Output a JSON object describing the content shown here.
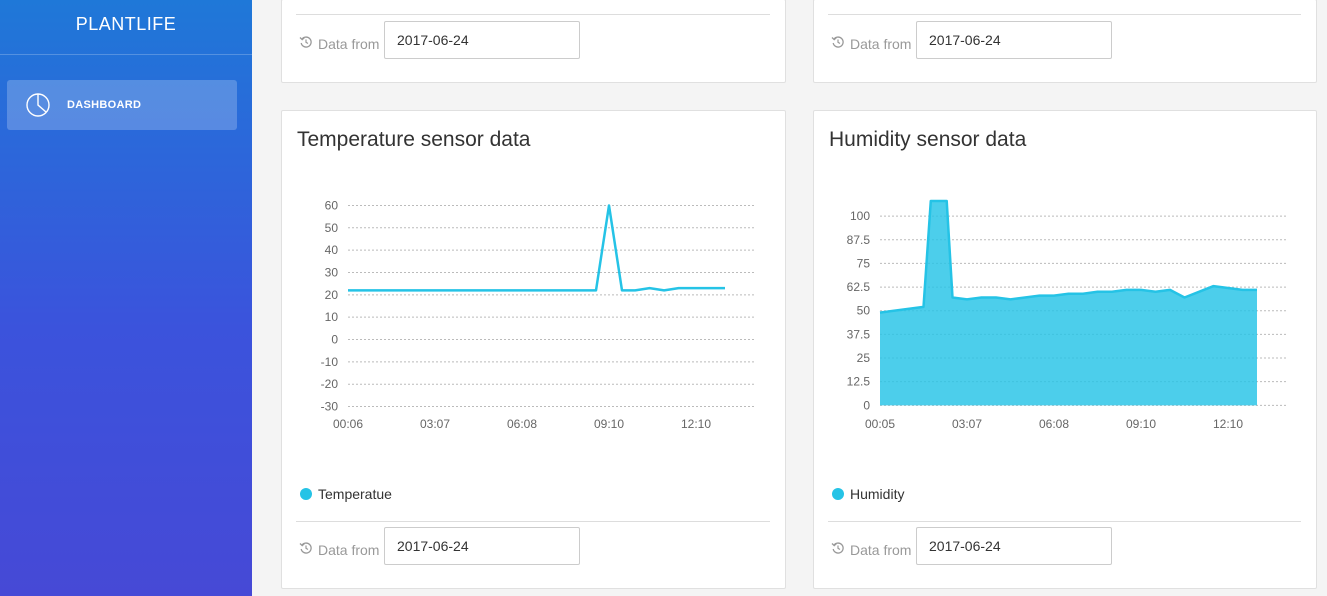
{
  "app": {
    "title": "PLANTLIFE"
  },
  "sidebar": {
    "items": [
      {
        "label": "DASHBOARD",
        "icon": "pie-chart-icon"
      }
    ]
  },
  "colors": {
    "accent": "#25c3e6",
    "sidebar_top": "#1f78d8",
    "sidebar_bottom": "#4649d6"
  },
  "top_cards": [
    {
      "footer": {
        "label": "Data from",
        "date": "2017-06-24",
        "icon": "history-icon"
      }
    },
    {
      "footer": {
        "label": "Data from",
        "date": "2017-06-24",
        "icon": "history-icon"
      }
    }
  ],
  "cards": [
    {
      "title": "Temperature sensor data",
      "legend": "Temperatue",
      "footer": {
        "label": "Data from",
        "date": "2017-06-24",
        "icon": "history-icon"
      }
    },
    {
      "title": "Humidity sensor data",
      "legend": "Humidity",
      "footer": {
        "label": "Data from",
        "date": "2017-06-24",
        "icon": "history-icon"
      }
    }
  ],
  "chart_data": [
    {
      "type": "line",
      "title": "Temperature sensor data",
      "xlabel": "",
      "ylabel": "",
      "x_ticks": [
        "00:06",
        "03:07",
        "06:08",
        "09:10",
        "12:10"
      ],
      "y_ticks": [
        60,
        50,
        40,
        30,
        20,
        10,
        0,
        -10,
        -20,
        -30
      ],
      "xlim": [
        0,
        14
      ],
      "ylim": [
        -32,
        62
      ],
      "grid": true,
      "legend_position": "bottom-left",
      "series": [
        {
          "name": "Temperatue",
          "color": "#25c3e6",
          "x": [
            0,
            8.55,
            9.0,
            9.45,
            9.9,
            10.4,
            10.9,
            11.4,
            12.0,
            13.0
          ],
          "y": [
            22,
            22,
            60,
            22,
            22,
            23,
            22,
            23,
            23,
            23
          ]
        }
      ]
    },
    {
      "type": "area",
      "title": "Humidity sensor data",
      "xlabel": "",
      "ylabel": "",
      "x_ticks": [
        "00:05",
        "03:07",
        "06:08",
        "09:10",
        "12:10"
      ],
      "y_ticks": [
        100,
        87.5,
        75,
        62.5,
        50,
        37.5,
        25,
        12.5,
        0
      ],
      "xlim": [
        0,
        14
      ],
      "ylim": [
        -3,
        108
      ],
      "grid": true,
      "legend_position": "bottom-left",
      "series": [
        {
          "name": "Humidity",
          "color": "#25c3e6",
          "x": [
            0,
            1.5,
            1.75,
            2.3,
            2.5,
            3.0,
            3.5,
            4.0,
            4.5,
            5.0,
            5.5,
            6.0,
            6.5,
            7.0,
            7.5,
            8.0,
            8.5,
            9.0,
            9.5,
            10.0,
            10.5,
            11.0,
            11.5,
            12.0,
            12.5,
            13.0
          ],
          "y": [
            49,
            52,
            108,
            108,
            57,
            56,
            57,
            57,
            56,
            57,
            58,
            58,
            59,
            59,
            60,
            60,
            61,
            61,
            60,
            61,
            57,
            60,
            63,
            62,
            61,
            61
          ]
        }
      ]
    }
  ]
}
